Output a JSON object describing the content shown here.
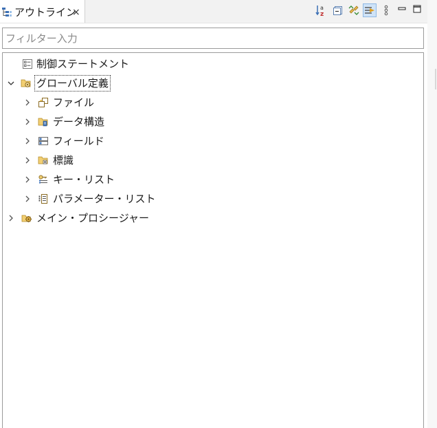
{
  "tab": {
    "title": "アウトライン",
    "close_label": "×"
  },
  "toolbar": {
    "items": [
      {
        "icon": "sort-az-icon"
      },
      {
        "icon": "collapse-all-icon"
      },
      {
        "icon": "link-with-editor-icon"
      },
      {
        "icon": "filter-icon",
        "active": true
      },
      {
        "icon": "view-menu-icon"
      },
      {
        "icon": "minimize-icon"
      },
      {
        "icon": "maximize-icon"
      }
    ]
  },
  "filter": {
    "placeholder": "フィルター入力",
    "value": ""
  },
  "tree": {
    "items": [
      {
        "label": "制御ステートメント",
        "icon": "control-statement-icon",
        "level": 0,
        "expandable": false
      },
      {
        "label": "グローバル定義",
        "icon": "folder-gear-icon",
        "level": 0,
        "expandable": true,
        "expanded": true,
        "focused": true
      },
      {
        "label": "ファイル",
        "icon": "file-copy-icon",
        "level": 1,
        "expandable": true,
        "expanded": false
      },
      {
        "label": "データ構造",
        "icon": "folder-data-icon",
        "level": 1,
        "expandable": true,
        "expanded": false
      },
      {
        "label": "フィールド",
        "icon": "field-icon",
        "level": 1,
        "expandable": true,
        "expanded": false
      },
      {
        "label": "標識",
        "icon": "folder-indicator-icon",
        "level": 1,
        "expandable": true,
        "expanded": false
      },
      {
        "label": "キー・リスト",
        "icon": "key-list-icon",
        "level": 1,
        "expandable": true,
        "expanded": false
      },
      {
        "label": "パラメーター・リスト",
        "icon": "parameter-list-icon",
        "level": 1,
        "expandable": true,
        "expanded": false
      },
      {
        "label": "メイン・プロシージャー",
        "icon": "procedure-gear-icon",
        "level": 0,
        "expandable": true,
        "expanded": false
      }
    ]
  },
  "colors": {
    "folder": "#e8b84a",
    "accent_blue": "#3b6fb5",
    "border": "#9a9a9a",
    "active_tool": "#cfe3f7"
  }
}
